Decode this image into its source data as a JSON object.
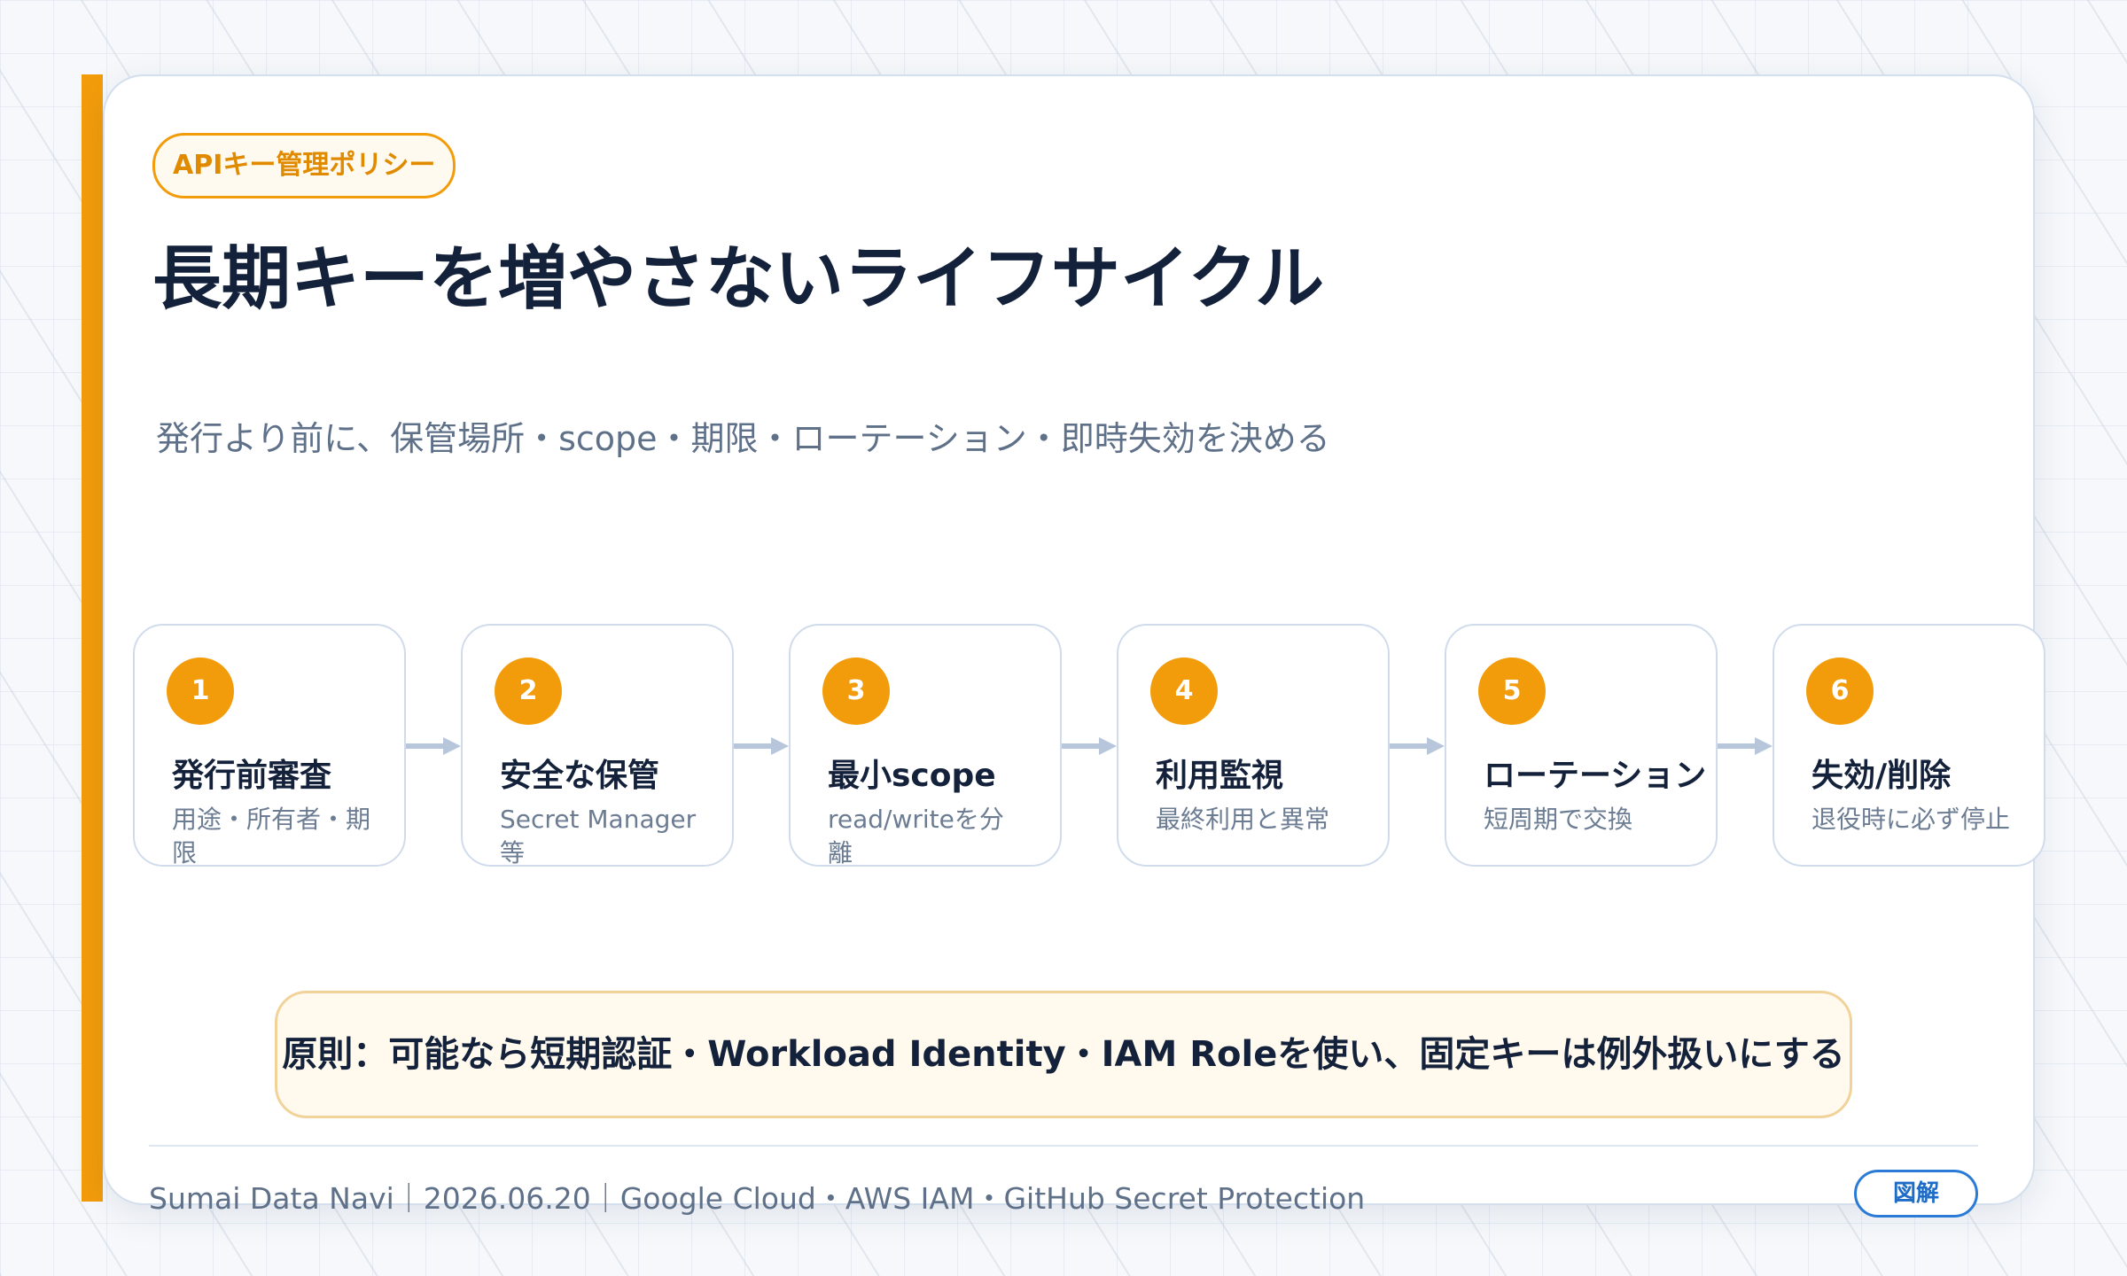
{
  "tag": "APIキー管理ポリシー",
  "title": "長期キーを増やさないライフサイクル",
  "subtitle": "発行より前に、保管場所・scope・期限・ローテーション・即時失効を決める",
  "steps": [
    {
      "num": "1",
      "label": "発行前審査",
      "desc": "用途・所有者・期限"
    },
    {
      "num": "2",
      "label": "安全な保管",
      "desc": "Secret Manager等"
    },
    {
      "num": "3",
      "label": "最小scope",
      "desc": "read/writeを分離"
    },
    {
      "num": "4",
      "label": "利用監視",
      "desc": "最終利用と異常"
    },
    {
      "num": "5",
      "label": "ローテーション",
      "desc": "短周期で交換"
    },
    {
      "num": "6",
      "label": "失効/削除",
      "desc": "退役時に必ず停止"
    }
  ],
  "principle": "原則：可能なら短期認証・Workload Identity・IAM Roleを使い、固定キーは例外扱いにする",
  "footer": {
    "text": "Sumai Data Navi｜2026.06.20｜Google Cloud・AWS IAM・GitHub Secret Protection",
    "badge": "図解"
  },
  "colors": {
    "accent": "#f39c0b",
    "title": "#14213a",
    "muted": "#5f7089",
    "border": "#d0dcec",
    "arrow": "#b7c6da",
    "badge": "#2b7bd6"
  }
}
